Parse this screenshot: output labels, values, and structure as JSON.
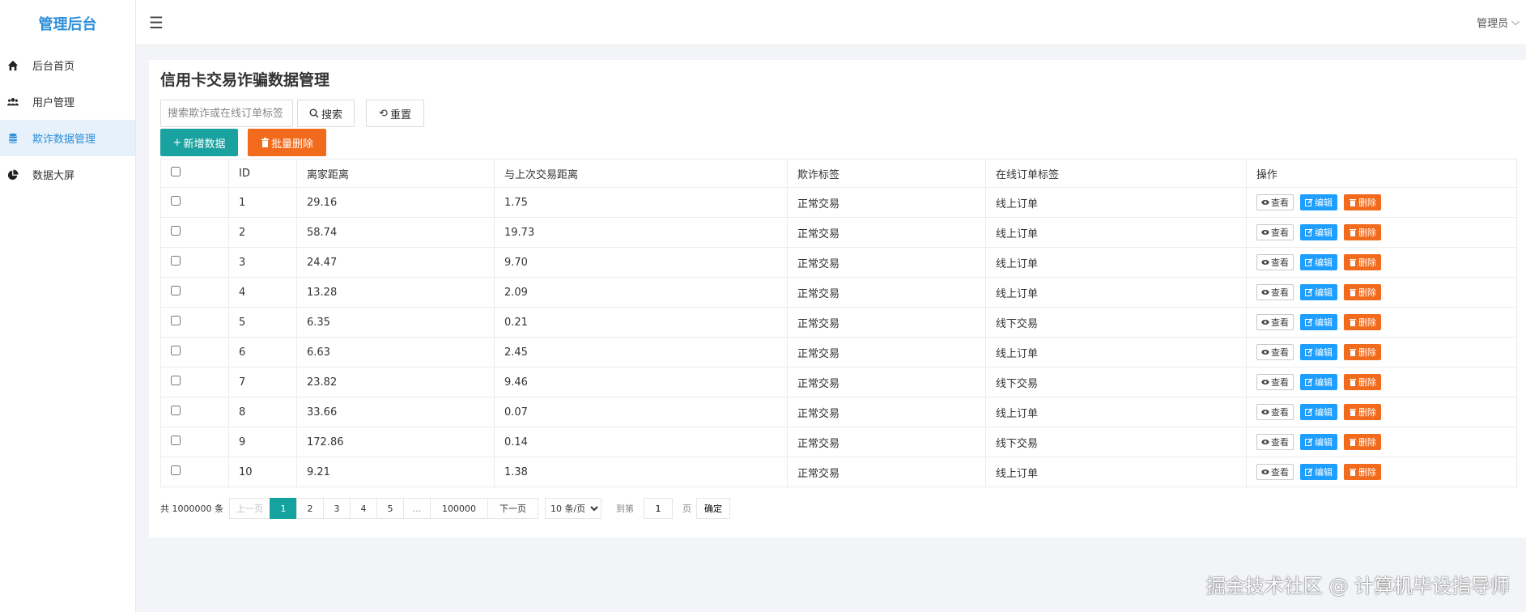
{
  "colors": {
    "brand": "#2d8fd9",
    "teal": "#1aa2a0",
    "orange": "#f26a1c",
    "blue": "#1e9fff"
  },
  "sidebar": {
    "brand": "管理后台",
    "items": [
      {
        "label": "后台首页",
        "icon": "home-icon"
      },
      {
        "label": "用户管理",
        "icon": "users-icon"
      },
      {
        "label": "欺诈数据管理",
        "icon": "database-icon",
        "active": true
      },
      {
        "label": "数据大屏",
        "icon": "pie-chart-icon"
      }
    ]
  },
  "header": {
    "user": "管理员"
  },
  "page": {
    "title": "信用卡交易诈骗数据管理"
  },
  "toolbar": {
    "search_placeholder": "搜索欺诈或在线订单标签",
    "search_label": "搜索",
    "reset_label": "重置",
    "add_label": "新增数据",
    "batch_delete_label": "批量删除"
  },
  "table": {
    "headers": [
      "ID",
      "离家距离",
      "与上次交易距离",
      "欺诈标签",
      "在线订单标签",
      "操作"
    ],
    "actions": {
      "view": "查看",
      "edit": "编辑",
      "delete": "删除"
    },
    "rows": [
      [
        "1",
        "29.16",
        "1.75",
        "正常交易",
        "线上订单"
      ],
      [
        "2",
        "58.74",
        "19.73",
        "正常交易",
        "线上订单"
      ],
      [
        "3",
        "24.47",
        "9.70",
        "正常交易",
        "线上订单"
      ],
      [
        "4",
        "13.28",
        "2.09",
        "正常交易",
        "线上订单"
      ],
      [
        "5",
        "6.35",
        "0.21",
        "正常交易",
        "线下交易"
      ],
      [
        "6",
        "6.63",
        "2.45",
        "正常交易",
        "线上订单"
      ],
      [
        "7",
        "23.82",
        "9.46",
        "正常交易",
        "线下交易"
      ],
      [
        "8",
        "33.66",
        "0.07",
        "正常交易",
        "线上订单"
      ],
      [
        "9",
        "172.86",
        "0.14",
        "正常交易",
        "线下交易"
      ],
      [
        "10",
        "9.21",
        "1.38",
        "正常交易",
        "线上订单"
      ]
    ]
  },
  "pagination": {
    "total": "共 1000000 条",
    "prev": "上一页",
    "pages": [
      "1",
      "2",
      "3",
      "4",
      "5",
      "…",
      "100000"
    ],
    "current": "1",
    "next": "下一页",
    "page_size": "10 条/页",
    "goto": "到第",
    "goto_value": "1",
    "unit": "页",
    "confirm": "确定"
  },
  "watermark": "掘金技术社区 @ 计算机毕设指导师"
}
